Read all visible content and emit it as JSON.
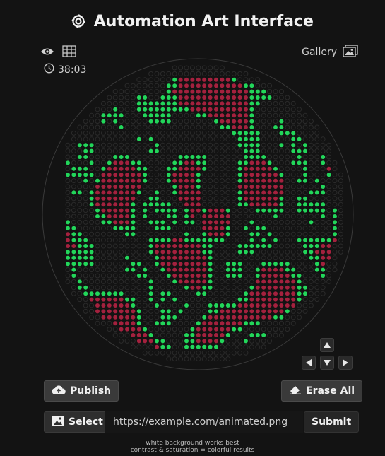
{
  "header": {
    "title": "Automation Art Interface",
    "logo_icon": "flower-gear-icon"
  },
  "toolbar": {
    "preview_icon": "eye-icon",
    "grid_icon": "grid-icon",
    "timer": "38:03",
    "timer_icon": "clock-icon"
  },
  "gallery": {
    "label": "Gallery",
    "icon": "gallery-icon"
  },
  "colors": {
    "green": "#22d65a",
    "red": "#a4213e",
    "empty": "#2a2a2a",
    "background": "#131313"
  },
  "controls": {
    "up_icon": "arrow-up-icon",
    "left_icon": "arrow-left-icon",
    "down_icon": "arrow-down-icon",
    "right_icon": "arrow-right-icon"
  },
  "actions": {
    "publish_label": "Publish",
    "erase_label": "Erase All"
  },
  "upload": {
    "select_label": "Select",
    "url_value": "https://example.com/animated.png",
    "submit_label": "Submit"
  },
  "hints": {
    "line1": "white background works best",
    "line2": "contrast & saturation = colorful results"
  }
}
